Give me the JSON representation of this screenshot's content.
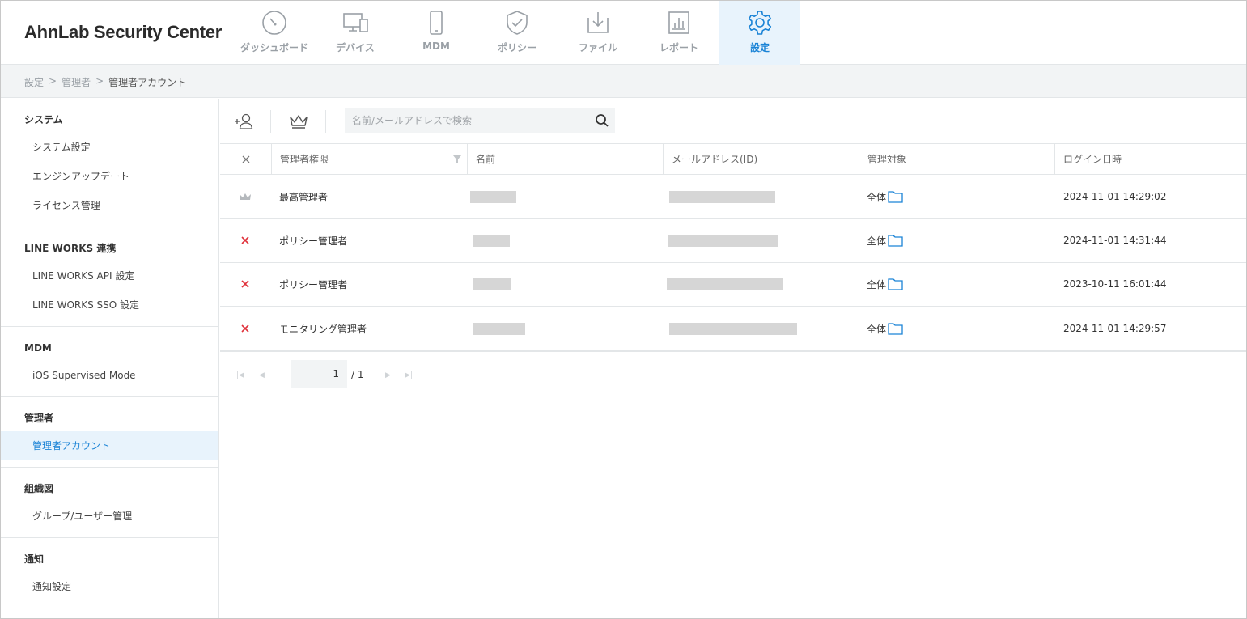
{
  "app": {
    "title": "AhnLab Security Center"
  },
  "nav": [
    {
      "label": "ダッシュボード",
      "icon": "dashboard-icon",
      "active": false
    },
    {
      "label": "デバイス",
      "icon": "device-icon",
      "active": false
    },
    {
      "label": "MDM",
      "icon": "mobile-icon",
      "active": false
    },
    {
      "label": "ポリシー",
      "icon": "shield-icon",
      "active": false
    },
    {
      "label": "ファイル",
      "icon": "file-download-icon",
      "active": false
    },
    {
      "label": "レポート",
      "icon": "report-icon",
      "active": false
    },
    {
      "label": "設定",
      "icon": "gear-icon",
      "active": true
    }
  ],
  "breadcrumb": {
    "items": [
      "設定",
      "管理者"
    ],
    "separator": ">",
    "current": "管理者アカウント"
  },
  "sidebar": {
    "sections": [
      {
        "title": "システム",
        "items": [
          {
            "label": "システム設定"
          },
          {
            "label": "エンジンアップデート"
          },
          {
            "label": "ライセンス管理"
          }
        ]
      },
      {
        "title": "LINE WORKS 連携",
        "items": [
          {
            "label": "LINE WORKS API 設定"
          },
          {
            "label": "LINE WORKS SSO 設定"
          }
        ]
      },
      {
        "title": "MDM",
        "items": [
          {
            "label": "iOS Supervised Mode"
          }
        ]
      },
      {
        "title": "管理者",
        "items": [
          {
            "label": "管理者アカウント",
            "active": true
          }
        ]
      },
      {
        "title": "組織図",
        "items": [
          {
            "label": "グループ/ユーザー管理"
          }
        ]
      },
      {
        "title": "通知",
        "items": [
          {
            "label": "通知設定"
          }
        ]
      }
    ]
  },
  "toolbar": {
    "add_icon": "add-user-icon",
    "crown_icon": "crown-icon",
    "search_placeholder": "名前/メールアドレスで検索",
    "search_icon": "search-icon"
  },
  "table": {
    "columns": [
      "管理者権限",
      "名前",
      "メールアドレス(ID)",
      "管理対象",
      "ログイン日時"
    ],
    "rows": [
      {
        "icon": "crown-icon",
        "role": "最高管理者",
        "target": "全体",
        "login": "2024-11-01 14:29:02"
      },
      {
        "icon": "delete-icon",
        "role": "ポリシー管理者",
        "target": "全体",
        "login": "2024-11-01 14:31:44"
      },
      {
        "icon": "delete-icon",
        "role": "ポリシー管理者",
        "target": "全体",
        "login": "2023-10-11 16:01:44"
      },
      {
        "icon": "delete-icon",
        "role": "モニタリング管理者",
        "target": "全体",
        "login": "2024-11-01 14:29:57"
      }
    ]
  },
  "pager": {
    "current": "1",
    "total": "/ 1"
  },
  "colors": {
    "accent": "#1a83d6",
    "delete": "#e0313a",
    "active_bg": "#e8f3fc"
  }
}
